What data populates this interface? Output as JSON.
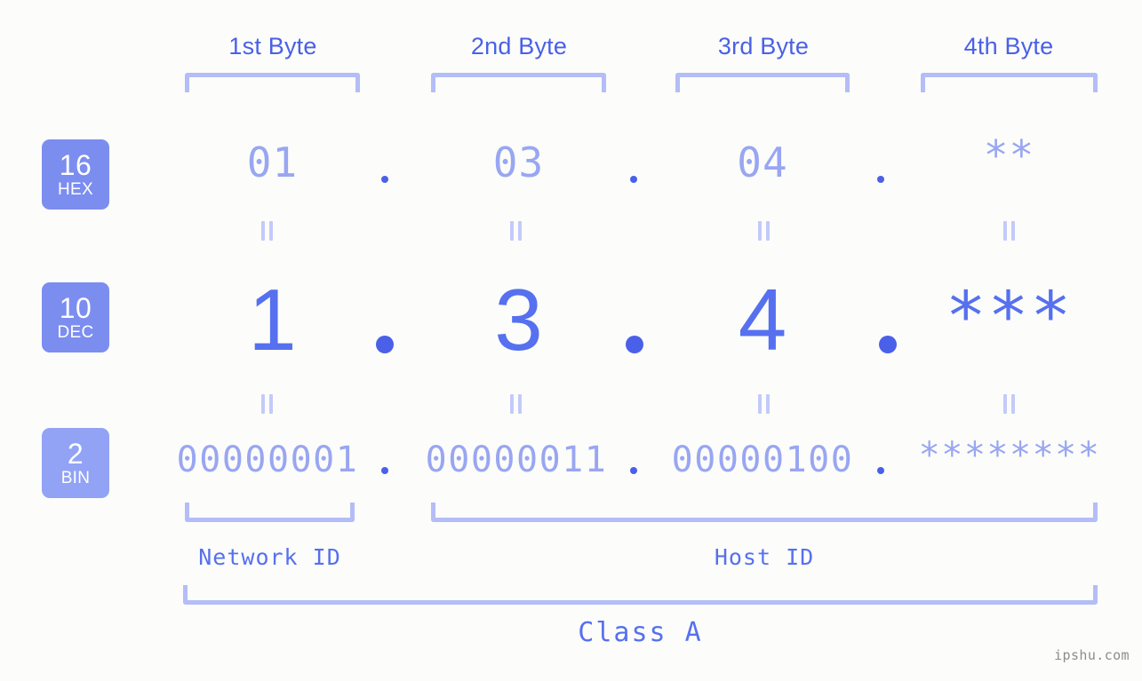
{
  "meta": {
    "background_color": "#fcfdfa",
    "accent_strong": "#4a60e8",
    "accent_medium": "#5670ef",
    "accent_light": "#99a6f2",
    "bracket_color": "#b4bdf7",
    "eq_color": "#c3cafa",
    "watermark": "ipshu.com"
  },
  "headers": {
    "bytes": [
      {
        "label": "1st Byte"
      },
      {
        "label": "2nd Byte"
      },
      {
        "label": "3rd Byte"
      },
      {
        "label": "4th Byte"
      }
    ]
  },
  "radix_badges": [
    {
      "number": "16",
      "base": "HEX",
      "color": "#7c8df0"
    },
    {
      "number": "10",
      "base": "DEC",
      "color": "#7c8df0"
    },
    {
      "number": "2",
      "base": "BIN",
      "color": "#92a3f5"
    }
  ],
  "rows": {
    "hex": {
      "radix_number": "16",
      "radix_base": "HEX",
      "values": [
        "01",
        "03",
        "04",
        "**"
      ],
      "separator": "."
    },
    "dec": {
      "radix_number": "10",
      "radix_base": "DEC",
      "values": [
        "1",
        "3",
        "4",
        "***"
      ],
      "separator": "."
    },
    "bin": {
      "radix_number": "2",
      "radix_base": "BIN",
      "values": [
        "00000001",
        "00000011",
        "00000100",
        "********"
      ],
      "separator": "."
    }
  },
  "equality_marks": {
    "symbol": "=",
    "count_per_row_gap": 4
  },
  "footer": {
    "network_id_label": "Network ID",
    "host_id_label": "Host ID",
    "class_label": "Class A"
  }
}
